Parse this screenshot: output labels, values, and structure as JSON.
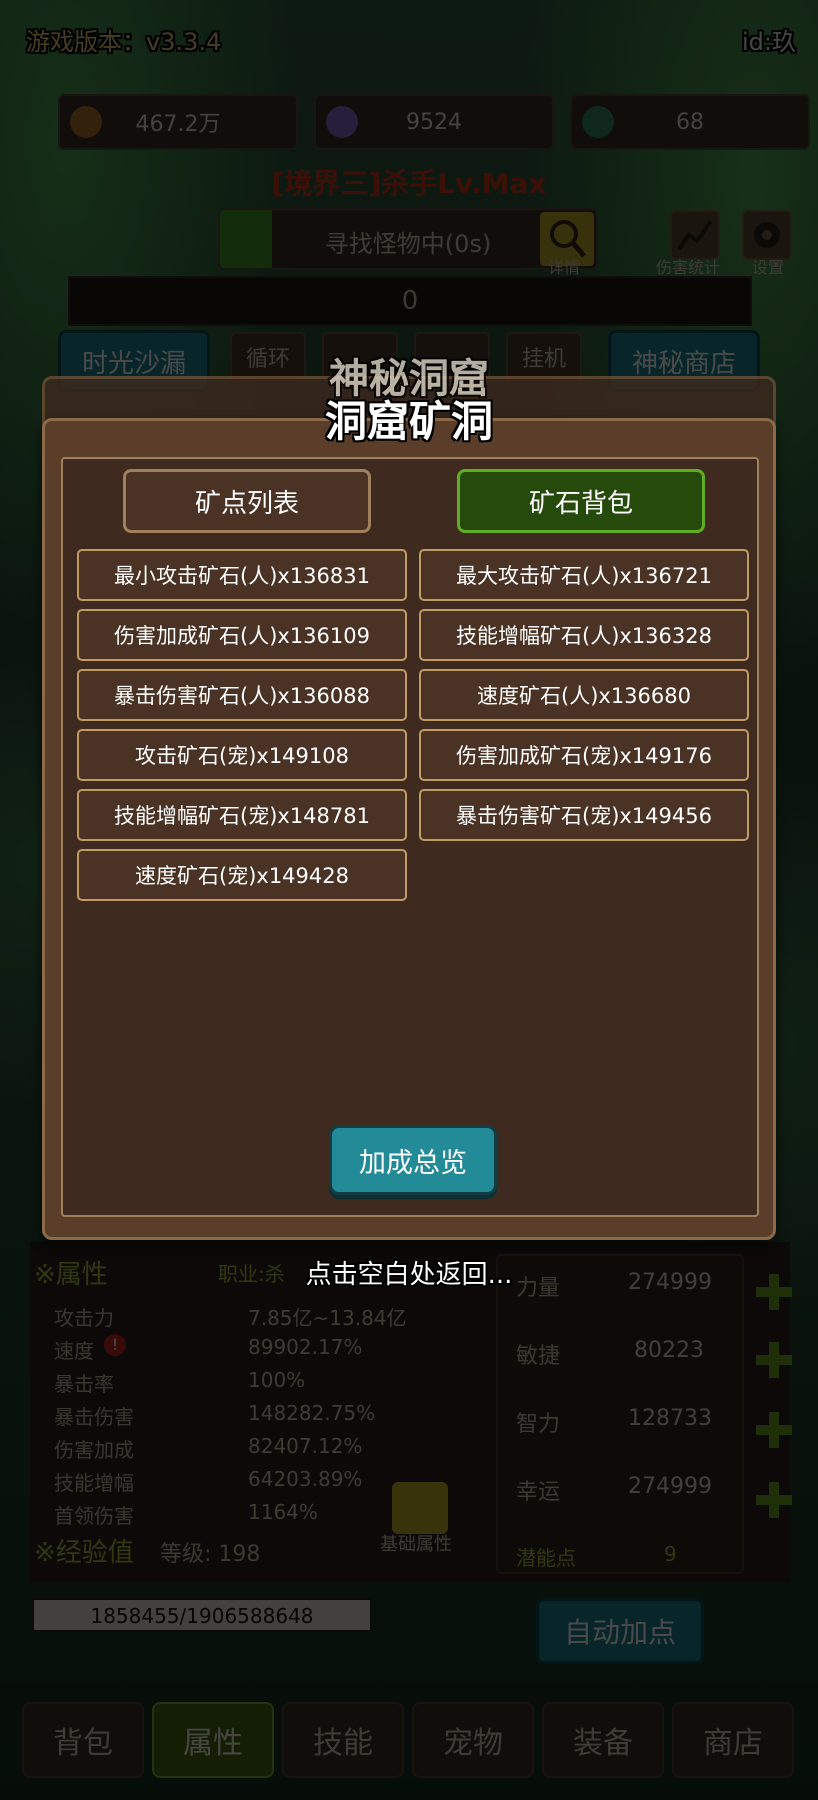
{
  "header": {
    "version": "游戏版本：v3.3.4",
    "id": "id:玖"
  },
  "stats": {
    "gold": "467.2万",
    "crystal": "9524",
    "feather": "68"
  },
  "player_title": "[境界三]杀手Lv.Max",
  "search_bar": {
    "text": "寻找怪物中(0s)",
    "detail_label": "详情"
  },
  "top_buttons": {
    "damage_stats": "伤害统计",
    "settings": "设置"
  },
  "damage_value": "0",
  "mid_buttons": {
    "time_sand": "时光沙漏",
    "loop": "循环",
    "idle": "挂机",
    "mystery_shop": "神秘商店"
  },
  "back_popup_title": "神秘洞窟",
  "modal": {
    "title": "洞窟矿洞",
    "tabs": {
      "list": "矿点列表",
      "bag": "矿石背包"
    },
    "ores": [
      "最小攻击矿石(人)x136831",
      "最大攻击矿石(人)x136721",
      "伤害加成矿石(人)x136109",
      "技能增幅矿石(人)x136328",
      "暴击伤害矿石(人)x136088",
      "速度矿石(人)x136680",
      "攻击矿石(宠)x149108",
      "伤害加成矿石(宠)x149176",
      "技能增幅矿石(宠)x148781",
      "暴击伤害矿石(宠)x149456",
      "速度矿石(宠)x149428"
    ],
    "summary_button": "加成总览"
  },
  "return_hint": "点击空白处返回...",
  "attributes": {
    "section": "※属性",
    "job": "职业:杀",
    "rows": [
      {
        "label": "攻击力",
        "value": "7.85亿~13.84亿"
      },
      {
        "label": "速度",
        "value": "89902.17%"
      },
      {
        "label": "暴击率",
        "value": "100%"
      },
      {
        "label": "暴击伤害",
        "value": "148282.75%"
      },
      {
        "label": "伤害加成",
        "value": "82407.12%"
      },
      {
        "label": "技能增幅",
        "value": "64203.89%"
      },
      {
        "label": "首领伤害",
        "value": "1164%"
      }
    ],
    "base_attr_label": "基础属性"
  },
  "experience": {
    "section": "※经验值",
    "level": "等级: 198",
    "progress": "1858455/1906588648",
    "fraction": 0.001
  },
  "base_stats": [
    {
      "label": "力量",
      "value": "274999"
    },
    {
      "label": "敏捷",
      "value": "80223"
    },
    {
      "label": "智力",
      "value": "128733"
    },
    {
      "label": "幸运",
      "value": "274999"
    }
  ],
  "potential": {
    "label": "潜能点",
    "value": "9"
  },
  "auto_add": "自动加点",
  "bottom_nav": [
    "背包",
    "属性",
    "技能",
    "宠物",
    "装备",
    "商店"
  ],
  "colors": {
    "accent_green": "#5fae22",
    "teal": "#238a97",
    "modal_brown": "#3e2a1f",
    "title_red": "#d63a1a"
  }
}
